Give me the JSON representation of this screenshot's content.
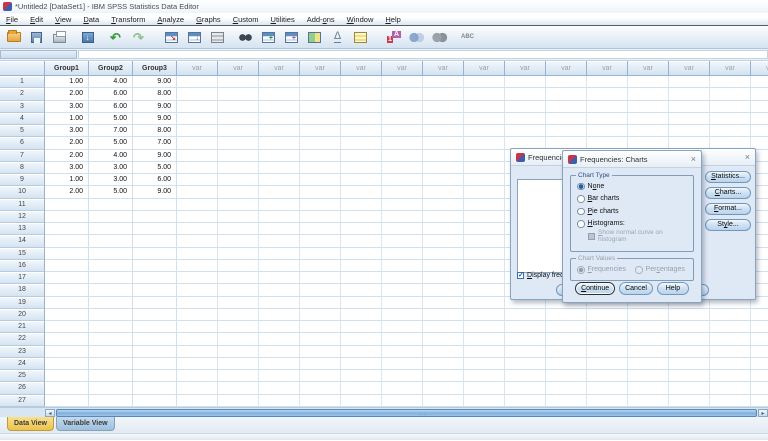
{
  "window": {
    "title": "*Untitled2 [DataSet1] - IBM SPSS Statistics Data Editor"
  },
  "menu": {
    "items": [
      "File",
      "Edit",
      "View",
      "Data",
      "Transform",
      "Analyze",
      "Graphs",
      "Custom",
      "Utilities",
      "Add-ons",
      "Window",
      "Help"
    ]
  },
  "toolbar": {
    "icons": [
      "open-data-document",
      "save-document",
      "print",
      "recall-recently-used-dialogs",
      "undo",
      "redo",
      "go-to-case",
      "go-to-variable",
      "variables",
      "find",
      "insert-cases",
      "insert-variable",
      "split-file",
      "weight-cases",
      "select-cases",
      "value-labels",
      "use-variable-sets",
      "show-all-variables",
      "spell-check"
    ]
  },
  "grid": {
    "columns": [
      "Group1",
      "Group2",
      "Group3"
    ],
    "var_headers": [
      "var",
      "var",
      "var",
      "var",
      "var",
      "var",
      "var",
      "var",
      "var",
      "var",
      "var",
      "var",
      "var",
      "var",
      "var"
    ],
    "rows": [
      {
        "n": "1",
        "c1": "1.00",
        "c2": "4.00",
        "c3": "9.00"
      },
      {
        "n": "2",
        "c1": "2.00",
        "c2": "6.00",
        "c3": "8.00"
      },
      {
        "n": "3",
        "c1": "3.00",
        "c2": "6.00",
        "c3": "9.00"
      },
      {
        "n": "4",
        "c1": "1.00",
        "c2": "5.00",
        "c3": "9.00"
      },
      {
        "n": "5",
        "c1": "3.00",
        "c2": "7.00",
        "c3": "8.00"
      },
      {
        "n": "6",
        "c1": "2.00",
        "c2": "5.00",
        "c3": "7.00"
      },
      {
        "n": "7",
        "c1": "2.00",
        "c2": "4.00",
        "c3": "9.00"
      },
      {
        "n": "8",
        "c1": "3.00",
        "c2": "3.00",
        "c3": "5.00"
      },
      {
        "n": "9",
        "c1": "1.00",
        "c2": "3.00",
        "c3": "6.00"
      },
      {
        "n": "10",
        "c1": "2.00",
        "c2": "5.00",
        "c3": "9.00"
      },
      {
        "n": "11",
        "c1": "",
        "c2": "",
        "c3": ""
      },
      {
        "n": "12",
        "c1": "",
        "c2": "",
        "c3": ""
      },
      {
        "n": "13",
        "c1": "",
        "c2": "",
        "c3": ""
      },
      {
        "n": "14",
        "c1": "",
        "c2": "",
        "c3": ""
      },
      {
        "n": "15",
        "c1": "",
        "c2": "",
        "c3": ""
      },
      {
        "n": "16",
        "c1": "",
        "c2": "",
        "c3": ""
      },
      {
        "n": "17",
        "c1": "",
        "c2": "",
        "c3": ""
      },
      {
        "n": "18",
        "c1": "",
        "c2": "",
        "c3": ""
      },
      {
        "n": "19",
        "c1": "",
        "c2": "",
        "c3": ""
      },
      {
        "n": "20",
        "c1": "",
        "c2": "",
        "c3": ""
      },
      {
        "n": "21",
        "c1": "",
        "c2": "",
        "c3": ""
      },
      {
        "n": "22",
        "c1": "",
        "c2": "",
        "c3": ""
      },
      {
        "n": "23",
        "c1": "",
        "c2": "",
        "c3": ""
      },
      {
        "n": "24",
        "c1": "",
        "c2": "",
        "c3": ""
      },
      {
        "n": "25",
        "c1": "",
        "c2": "",
        "c3": ""
      },
      {
        "n": "26",
        "c1": "",
        "c2": "",
        "c3": ""
      },
      {
        "n": "27",
        "c1": "",
        "c2": "",
        "c3": ""
      }
    ]
  },
  "tabs": {
    "data_view": "Data View",
    "variable_view": "Variable View"
  },
  "freq_dialog": {
    "title": "Frequencies",
    "close": "×",
    "checkbox_label": "Display freq",
    "buttons": {
      "statistics": "Statistics...",
      "charts": "Charts...",
      "format": "Format...",
      "style": "Style..."
    }
  },
  "charts_dialog": {
    "title": "Frequencies: Charts",
    "close": "×",
    "chart_type": {
      "legend": "Chart Type",
      "none": "None",
      "bar": "Bar charts",
      "pie": "Pie charts",
      "histograms": "Histograms:",
      "normal_curve": "Show normal curve on histogram",
      "selected": "None"
    },
    "chart_values": {
      "legend": "Chart Values",
      "frequencies": "Frequencies",
      "percentages": "Percentages",
      "selected": "Frequencies"
    },
    "buttons": {
      "continue": "Continue",
      "cancel": "Cancel",
      "help": "Help"
    }
  }
}
